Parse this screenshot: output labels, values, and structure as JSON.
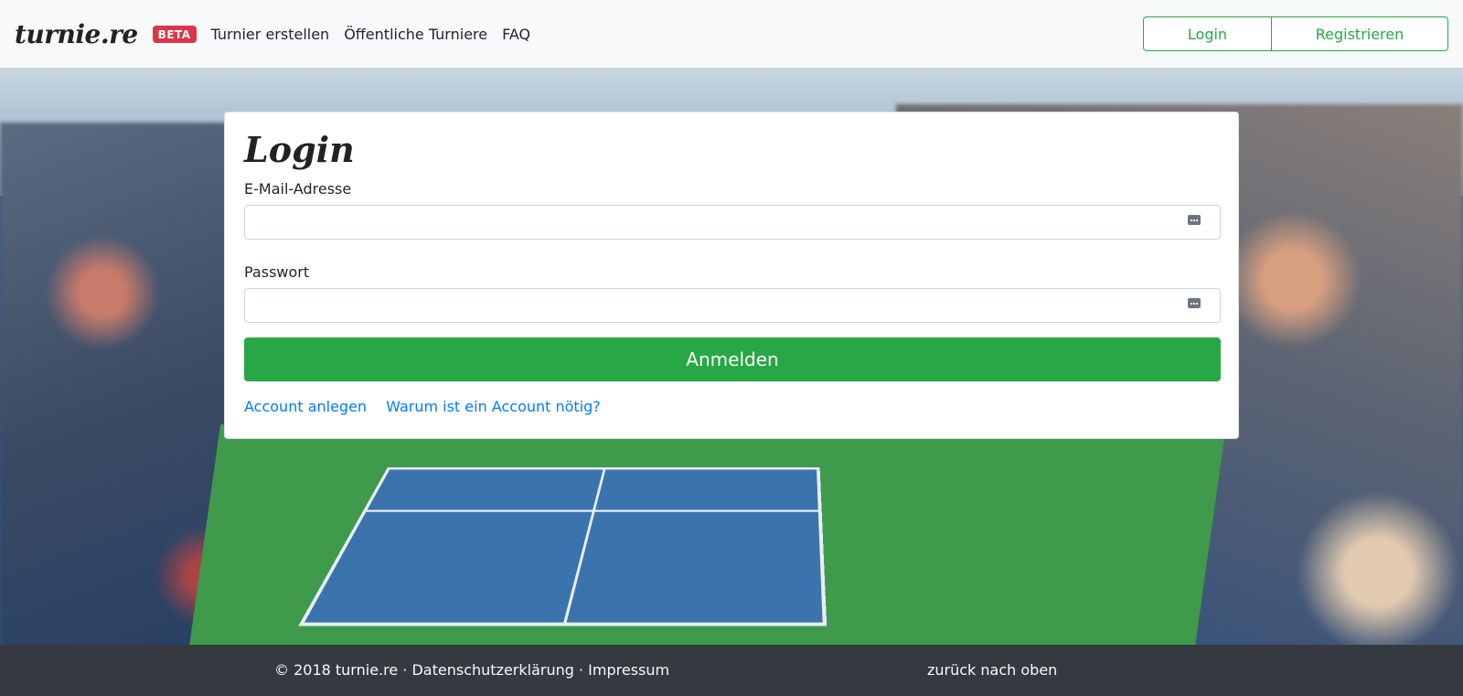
{
  "navbar": {
    "brand": "turnie.re",
    "beta_badge": "BETA",
    "links": [
      "Turnier erstellen",
      "Öffentliche Turniere",
      "FAQ"
    ],
    "login_label": "Login",
    "register_label": "Registrieren"
  },
  "login_card": {
    "title": "Login",
    "email_label": "E-Mail-Adresse",
    "email_value": "",
    "password_label": "Passwort",
    "password_value": "",
    "submit_label": "Anmelden",
    "create_account_link": "Account anlegen",
    "why_account_link": "Warum ist ein Account nötig?"
  },
  "footer": {
    "copyright": "© 2018 turnie.re",
    "separator": "·",
    "privacy_link": "Datenschutzerklärung",
    "imprint_link": "Impressum",
    "back_to_top": "zurück nach oben"
  },
  "colors": {
    "primary_green": "#28a745",
    "beta_red": "#dc3545",
    "link_blue": "#007bff",
    "footer_bg": "#343a40",
    "navbar_bg": "#f8f9fa"
  },
  "icons": {
    "input_addon": "password-manager-key-icon",
    "background": "tennis-stadium-image"
  }
}
